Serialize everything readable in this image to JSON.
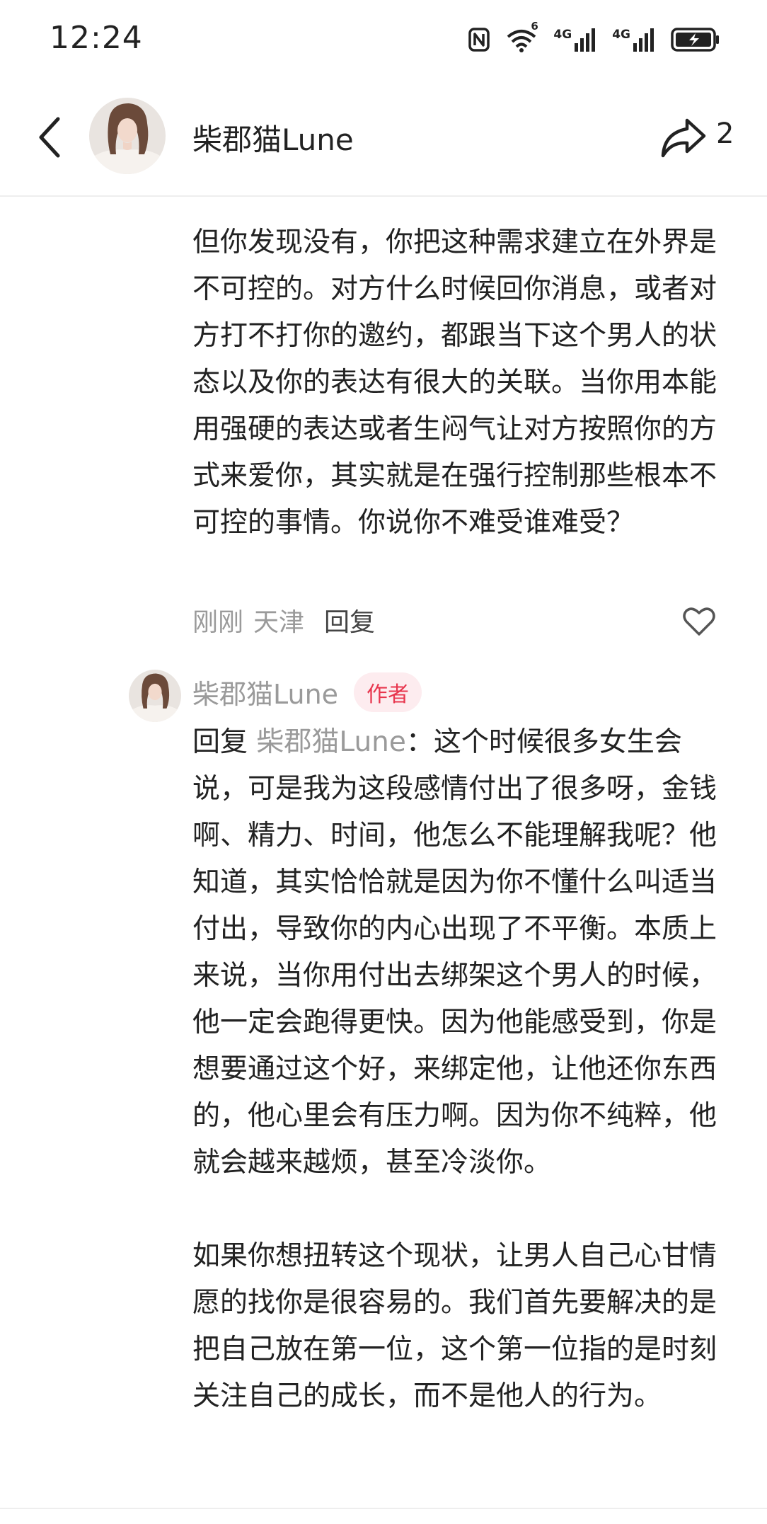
{
  "status_bar": {
    "time": "12:24",
    "icons": [
      "nfc-icon",
      "wifi-6-icon",
      "signal-4g-icon",
      "signal-4g-icon",
      "battery-charging-icon"
    ],
    "wifi_label": "6",
    "net1_label": "4G",
    "net2_label": "4G"
  },
  "header": {
    "name": "柴郡猫Lune",
    "share_count": "2"
  },
  "comment": {
    "text": "但你发现没有，你把这种需求建立在外界是不可控的。对方什么时候回你消息，或者对方打不打你的邀约，都跟当下这个男人的状态以及你的表达有很大的关联。当你用本能用强硬的表达或者生闷气让对方按照你的方式来爱你，其实就是在强行控制那些根本不可控的事情。你说你不难受谁难受？",
    "time": "刚刚",
    "location": "天津",
    "reply_label": "回复"
  },
  "reply": {
    "author": "柴郡猫Lune",
    "badge": "作者",
    "prefix": "回复",
    "target": "柴郡猫Lune",
    "colon": "：",
    "para1": "这个时候很多女生会说，可是我为这段感情付出了很多呀，金钱啊、精力、时间，他怎么不能理解我呢？他知道，其实恰恰就是因为你不懂什么叫适当付出，导致你的内心出现了不平衡。本质上来说，当你用付出去绑架这个男人的时候，他一定会跑得更快。因为他能感受到，你是想要通过这个好，来绑定他，让他还你东西的，他心里会有压力啊。因为你不纯粹，他就会越来越烦，甚至冷淡你。",
    "para2": "如果你想扭转这个现状，让男人自己心甘情愿的找你是很容易的。我们首先要解决的是把自己放在第一位，这个第一位指的是时刻关注自己的成长，而不是他人的行为。"
  },
  "colors": {
    "badge_text": "#e8364e",
    "badge_bg": "#fdecef",
    "meta_text": "#9a9a9a"
  }
}
